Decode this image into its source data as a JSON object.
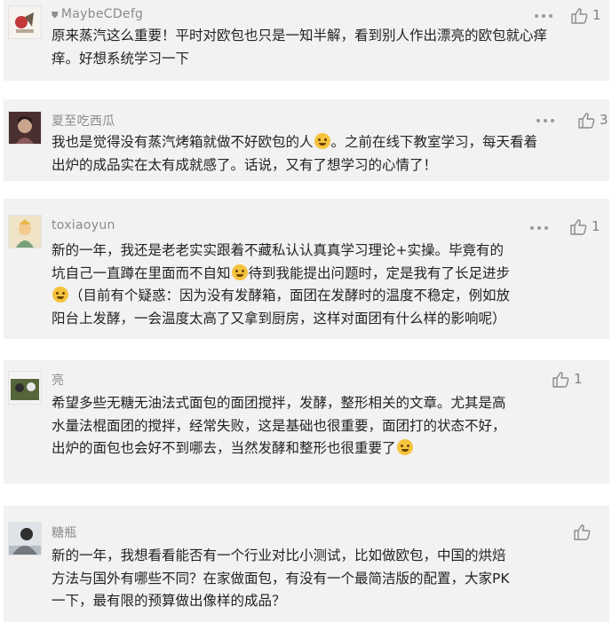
{
  "comments": [
    {
      "author": "MaybeCDefg",
      "likes": "1",
      "text_lines": [
        "原来蒸汽这么重要！平时对欧包也只是一知半解，看到别人作出漂亮的欧包就心痒",
        "痒。好想系统学习一下"
      ]
    },
    {
      "author": "夏至吃西瓜",
      "likes": "3",
      "text_lines": [
        "我也是觉得没有蒸汽烤箱就做不好欧包的人",
        "。之前在线下教室学习，每天看着",
        "出炉的成品实在太有成就感了。话说，又有了想学习的心情了！"
      ]
    },
    {
      "author": "toxiaoyun",
      "likes": "1",
      "text_lines": [
        "新的一年，我还是老老实实跟着不藏私认认真真学习理论+实操。毕竟有的",
        "坑自己一直蹲在里面而不自知",
        "待到我能提出问题时，定是我有了长足进步",
        "（目前有个疑惑：因为没有发酵箱，面团在发酵时的温度不稳定，例如放",
        "阳台上发酵，一会温度太高了又拿到厨房，这样对面团有什么样的影响呢）"
      ]
    },
    {
      "author": "亮",
      "likes": "1",
      "text_lines": [
        "希望多些无糖无油法式面包的面团搅拌，发酵，整形相关的文章。尤其是高",
        "水量法棍面团的搅拌，经常失败，这是基础也很重要，面团打的状态不好，",
        "出炉的面包也会好不到哪去，当然发酵和整形也很重要了"
      ]
    },
    {
      "author": "糖瓶",
      "likes": "",
      "text_lines": [
        "新的一年，我想看看能否有一个行业对比小测试，比如做欧包，中国的烘焙",
        "方法与国外有哪些不同？在家做面包，有没有一个最简洁版的配置，大家PK",
        "一下，最有限的预算做出像样的成品？"
      ]
    }
  ],
  "colors": {
    "card_bg": "#f2f2f2",
    "name": "#8b8b8b",
    "text": "#222222",
    "icon": "#8a8a8a"
  },
  "icons": {
    "more": "more-dots-icon",
    "like": "thumbs-up-icon",
    "verified": "shield-icon",
    "emoji": "smiley-emoji-icon"
  }
}
